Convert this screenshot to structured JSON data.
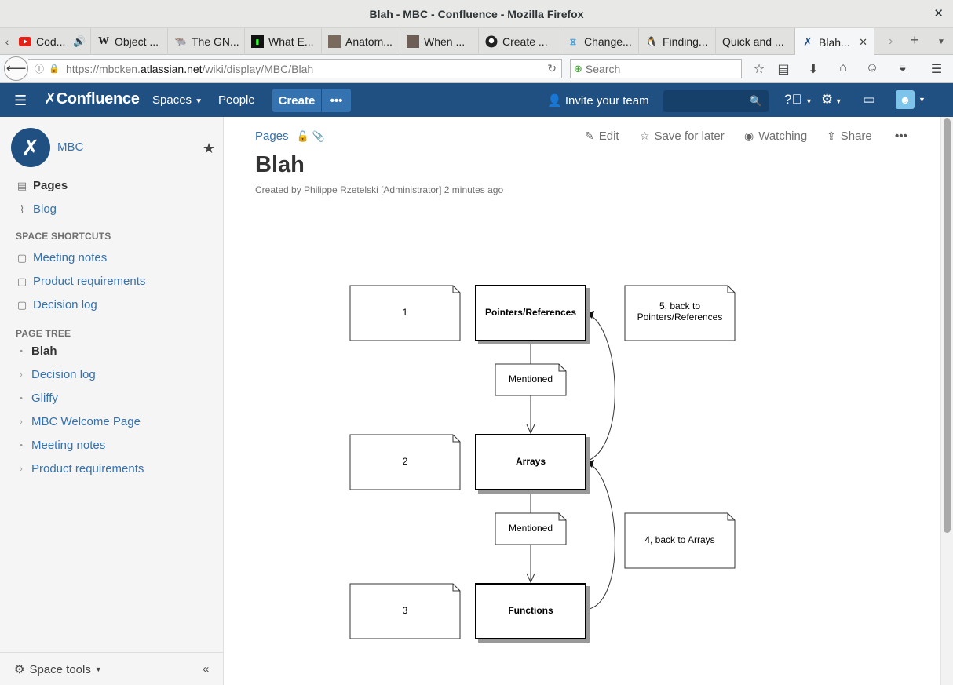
{
  "window": {
    "title": "Blah - MBC - Confluence - Mozilla Firefox"
  },
  "tabs": [
    {
      "label": "Cod...",
      "icon": "youtube-icon"
    },
    {
      "label": "Object ...",
      "icon": "wikipedia-icon"
    },
    {
      "label": "The GN...",
      "icon": "gnu-icon"
    },
    {
      "label": "What E...",
      "icon": "terminal-icon"
    },
    {
      "label": "Anatom...",
      "icon": "avatar-icon"
    },
    {
      "label": "When ...",
      "icon": "avatar-icon"
    },
    {
      "label": "Create ...",
      "icon": "github-icon"
    },
    {
      "label": "Change...",
      "icon": "confluence-icon"
    },
    {
      "label": "Finding...",
      "icon": "linux-icon"
    },
    {
      "label": "Quick and ...",
      "icon": ""
    },
    {
      "label": "Blah...",
      "icon": "confluence-icon"
    }
  ],
  "navbar": {
    "url_prefix": "https://mbcken.",
    "url_domain": "atlassian.net",
    "url_path": "/wiki/display/MBC/Blah",
    "search_placeholder": "Search"
  },
  "confluence_header": {
    "logo": "Confluence",
    "spaces": "Spaces",
    "people": "People",
    "create": "Create",
    "more": "•••",
    "invite": "Invite your team"
  },
  "sidebar": {
    "space_name": "MBC",
    "pages": "Pages",
    "blog": "Blog",
    "shortcuts_heading": "SPACE SHORTCUTS",
    "shortcuts": [
      "Meeting notes",
      "Product requirements",
      "Decision log"
    ],
    "tree_heading": "PAGE TREE",
    "tree": [
      {
        "label": "Blah",
        "current": true,
        "expand": false
      },
      {
        "label": "Decision log",
        "current": false,
        "expand": true
      },
      {
        "label": "Gliffy",
        "current": false,
        "expand": false
      },
      {
        "label": "MBC Welcome Page",
        "current": false,
        "expand": true
      },
      {
        "label": "Meeting notes",
        "current": false,
        "expand": false
      },
      {
        "label": "Product requirements",
        "current": false,
        "expand": true
      }
    ],
    "space_tools": "Space tools"
  },
  "page": {
    "breadcrumb": "Pages",
    "actions": {
      "edit": "Edit",
      "save_for_later": "Save for later",
      "watching": "Watching",
      "share": "Share"
    },
    "title": "Blah",
    "byline": "Created by Philippe Rzetelski [Administrator] 2 minutes ago"
  },
  "diagram": {
    "nodes": {
      "pointers": "Pointers/References",
      "arrays": "Arrays",
      "functions": "Functions"
    },
    "notes": {
      "n1": "1",
      "n2": "2",
      "n3": "3",
      "n4": "4, back to Arrays",
      "n5_line1": "5, back to",
      "n5_line2": "Pointers/References",
      "mentioned1": "Mentioned",
      "mentioned2": "Mentioned"
    }
  }
}
